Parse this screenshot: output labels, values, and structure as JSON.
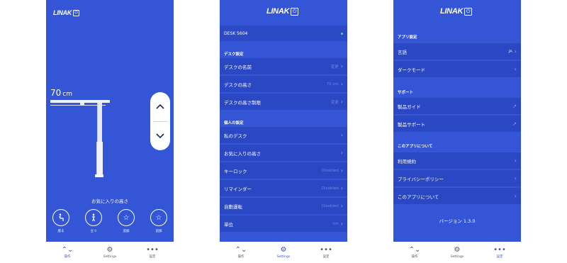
{
  "brand": {
    "name": "LINAK",
    "mark": "⏻"
  },
  "tabbar": {
    "tabs": [
      {
        "label": "操作",
        "icon": "up-down-icon"
      },
      {
        "label": "Settings",
        "icon": "gear-icon"
      },
      {
        "label": "設定",
        "icon": "more-icon"
      }
    ]
  },
  "control": {
    "height_value": "70",
    "height_unit": "cm",
    "favorites_title": "お気に入りの高さ",
    "favorites": [
      {
        "label": "座る",
        "icon": "sitting-person-icon"
      },
      {
        "label": "立つ",
        "icon": "standing-person-icon"
      },
      {
        "label": "追加",
        "icon": "star-icon"
      },
      {
        "label": "追加",
        "icon": "star-icon"
      }
    ]
  },
  "settings": {
    "device_name": "DESK 5604",
    "desk_section": "デスク設定",
    "desk_rows": [
      {
        "label": "デスクの名前",
        "value": "変更"
      },
      {
        "label": "デスクの高さ",
        "value": "70 cm"
      },
      {
        "label": "デスクの高さ制限",
        "value": "変更"
      }
    ],
    "personal_section": "個人の設定",
    "personal_rows": [
      {
        "label": "私のデスク",
        "value": ""
      },
      {
        "label": "お気に入りの高さ",
        "value": ""
      },
      {
        "label": "キーロック",
        "value": "Disabled"
      },
      {
        "label": "リマインダー",
        "value": "Disabled"
      },
      {
        "label": "自動運転",
        "value": "Disabled"
      },
      {
        "label": "単位",
        "value": "cm"
      }
    ]
  },
  "more": {
    "app_section": "アプリ設定",
    "app_rows": [
      {
        "label": "言語",
        "value": "JA"
      },
      {
        "label": "ダークモード",
        "value": ""
      }
    ],
    "support_section": "サポート",
    "support_rows": [
      {
        "label": "製品ガイド"
      },
      {
        "label": "製品サポート"
      }
    ],
    "about_section": "このアプリについて",
    "about_rows": [
      {
        "label": "利用規約"
      },
      {
        "label": "プライバシーポリシー"
      },
      {
        "label": "このアプリについて"
      }
    ],
    "version": "バージョン 1.3.0"
  },
  "colors": {
    "background": "#3455d6",
    "row": "#2b48c4",
    "status_online": "#3fe58a"
  }
}
